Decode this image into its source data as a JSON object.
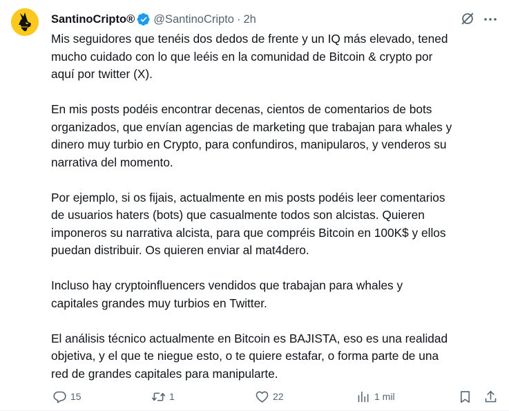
{
  "author": {
    "display_name": "SantinoCripto®",
    "handle": "@SantinoCripto",
    "separator": "·",
    "time": "2h",
    "verified_icon": "verified-badge-icon",
    "avatar_bg": "#fac81e"
  },
  "tweet": {
    "lines": [
      [
        "Mis seguidores que tenéis dos dedos de frente y un IQ más elevado, tened",
        "mucho cuidado con lo que leéis en la comunidad de Bitcoin & crypto por",
        "aquí por twitter (X)."
      ],
      [
        "En mis posts podéis encontrar decenas, cientos de comentarios de bots",
        "organizados, que envían agencias de marketing que trabajan para whales y",
        "dinero muy turbio en Crypto, para confundiros, manipularos, y venderos su",
        "narrativa del momento."
      ],
      [
        "Por ejemplo, si os fijais, actualmente en mis posts podéis leer comentarios",
        "de usuarios haters (bots) que casualmente todos son alcistas. Quieren",
        "imponeros su narrativa alcista, para que compréis Bitcoin en 100K$ y ellos",
        "puedan distribuir. Os quieren enviar al mat4dero."
      ],
      [
        "Incluso hay cryptoinfluencers vendidos que trabajan para whales y",
        "capitales grandes muy turbios en Twitter."
      ],
      [
        "El análisis técnico actualmente en Bitcoin es BAJISTA, eso es una realidad",
        "objetiva, y el que te niegue esto, o te quiere estafar, o forma parte de una",
        "red de grandes capitales para manipularte."
      ]
    ]
  },
  "actions": {
    "replies": "15",
    "reposts": "1",
    "likes": "22",
    "views": "1 mil"
  },
  "colors": {
    "text": "#0f1419",
    "secondary": "#536471",
    "verified": "#1d9bf0",
    "avatar_bg": "#fac81e"
  }
}
